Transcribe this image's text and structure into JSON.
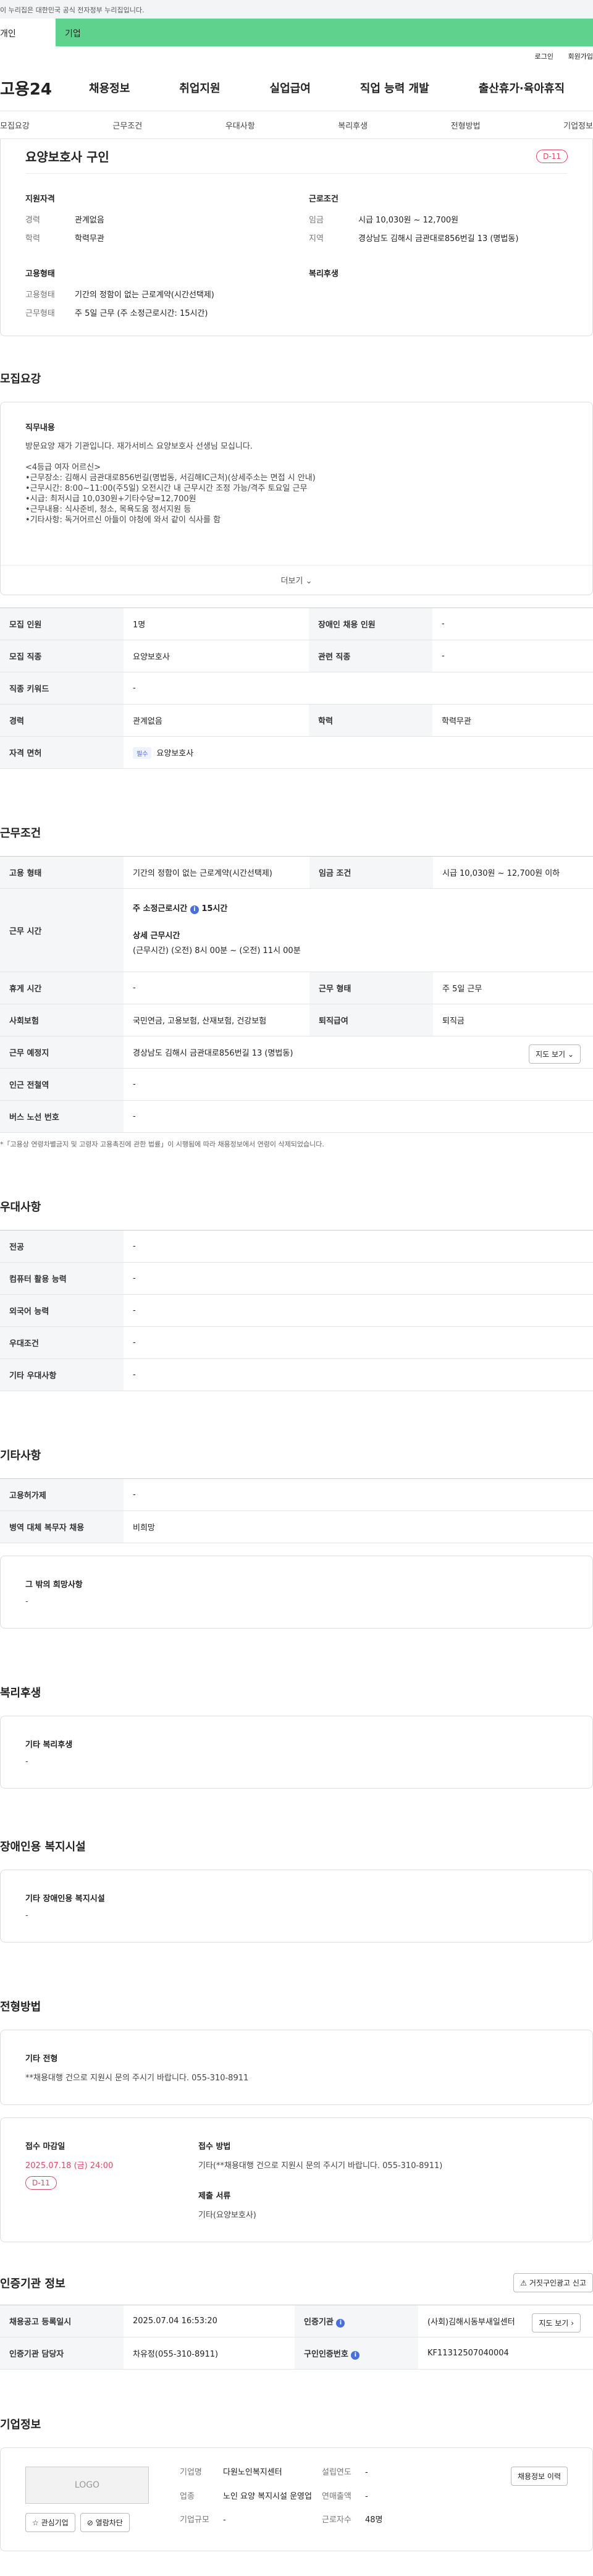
{
  "gov_banner": "이 누리집은 대한민국 공식 전자정부 누리집입니다.",
  "toggle": {
    "left": "개인",
    "right": "기업"
  },
  "util": {
    "login": "로그인",
    "join": "회원가입"
  },
  "gnb": {
    "logo": "고용24",
    "menus": [
      "채용정보",
      "취업지원",
      "실업급여",
      "직업 능력 개발",
      "출산휴가·육아휴직"
    ]
  },
  "subnav": [
    "모집요강",
    "근무조건",
    "우대사항",
    "복리후생",
    "전형방법",
    "기업정보"
  ],
  "summary": {
    "title": "요양보호사 구인",
    "dday": "D-11",
    "qual_title": "지원자격",
    "qual": [
      {
        "k": "경력",
        "v": "관계없음"
      },
      {
        "k": "학력",
        "v": "학력무관"
      }
    ],
    "cond_title": "근로조건",
    "cond": [
      {
        "k": "임금",
        "v": "시급 10,030원 ~ 12,700원"
      },
      {
        "k": "지역",
        "v": "경상남도 김해시 금관대로856번길 13 (명법동)"
      }
    ],
    "emp_title": "고용형태",
    "emp": [
      {
        "k": "고용형태",
        "v": "기간의 정함이 없는 근로계약(시간선택제)"
      },
      {
        "k": "근무형태",
        "v": "주 5일 근무 (주 소정근로시간: 15시간)"
      }
    ],
    "welfare_title": "복리후생"
  },
  "recruit": {
    "title": "모집요강",
    "desc_title": "직무내용",
    "desc_text": "방문요양 재가 기관입니다. 재가서비스 요양보호사 선생님 모십니다.\n\n<4등급 여자 어르신>\n•근무장소: 김해시 금관대로856번길(명법동, 서김해IC근처)(상세주소는 면접 시 안내)\n•근무시간: 8:00~11:00(주5일) 오전시간 내 근무시간 조정 가능/격주 토요일 근무\n•시급: 최저시급 10,030원+기타수당=12,700원\n•근무내용: 식사준비, 청소, 목욕도움 정서지원 등\n•기타사항: 독거어르신 아들이 야청에 와서 같이 식사를 함",
    "more": "더보기",
    "rows": [
      [
        {
          "h": "모집 인원"
        },
        {
          "v": "1명"
        },
        {
          "h": "장애인 채용 인원"
        },
        {
          "v": "-"
        }
      ],
      [
        {
          "h": "모집 직종"
        },
        {
          "v": "요양보호사"
        },
        {
          "h": "관련 직종"
        },
        {
          "v": "-"
        }
      ],
      [
        {
          "h": "직종 키워드"
        },
        {
          "v": "-"
        }
      ],
      [
        {
          "h": "경력"
        },
        {
          "v": "관계없음"
        },
        {
          "h": "학력"
        },
        {
          "v": "학력무관"
        }
      ]
    ],
    "license_h": "자격 면허",
    "license_tag": "필수",
    "license_v": "요양보호사"
  },
  "work": {
    "title": "근무조건",
    "emp_h": "고용 형태",
    "emp_v": "기간의 정함이 없는 근로계약(시간선택제)",
    "wage_h": "임금 조건",
    "wage_v": "시급 10,030원 ~ 12,700원 이하",
    "time_h": "근무 시간",
    "time_l1": "주 소정근로시간",
    "time_l1v": "15시간",
    "time_l2": "상세 근무시간",
    "time_l3": "(근무시간) (오전) 8시 00분 ~ (오전) 11시 00분",
    "rest_h": "휴게 시간",
    "rest_v": "-",
    "form_h": "근무 형태",
    "form_v": "주 5일 근무",
    "ins_h": "사회보험",
    "ins_v": "국민연금, 고용보험, 산재보험, 건강보험",
    "ret_h": "퇴직급여",
    "ret_v": "퇴직금",
    "place_h": "근무 예정지",
    "place_v": "경상남도 김해시 금관대로856번길 13 (명법동)",
    "map_btn": "지도 보기",
    "sub_h": "인근 전철역",
    "sub_v": "-",
    "bus_h": "버스 노선 번호",
    "bus_v": "-",
    "notice": "*「고용상 연령차별금지 및 고령자 고용촉진에 관한 법률」이 시행됨에 따라 채용정보에서 연령이 삭제되었습니다."
  },
  "pref": {
    "title": "우대사항",
    "rows": [
      [
        "전공",
        "-"
      ],
      [
        "컴퓨터 활용 능력",
        "-"
      ],
      [
        "외국어 능력",
        "-"
      ],
      [
        "우대조건",
        "-"
      ],
      [
        "기타 우대사항",
        "-"
      ]
    ]
  },
  "etc": {
    "title": "기타사항",
    "rows": [
      [
        "고용허가제",
        "-"
      ],
      [
        "병역 대체 복무자 채용",
        "비희망"
      ]
    ],
    "box_title": "그 밖의 희망사항",
    "box_v": "-"
  },
  "welfare": {
    "title": "복리후생",
    "box_title": "기타 복리후생",
    "box_v": "-"
  },
  "disabled": {
    "title": "장애인용 복지시설",
    "box_title": "기타 장애인용 복지시설",
    "box_v": "-"
  },
  "select": {
    "title": "전형방법",
    "box_title": "기타 전형",
    "box_v": "**채용대행 건으로 지원시 문의 주시기 바랍니다. 055-310-8911",
    "dl_title": "접수 마감일",
    "dl_v": "2025.07.18 (금) 24:00",
    "dl_dday": "D-11",
    "method_title": "접수 방법",
    "method_v": "기타(**채용대행 건으로 지원시 문의 주시기 바랍니다. 055-310-8911)",
    "doc_title": "제출 서류",
    "doc_v": "기타(요양보호사)"
  },
  "cert": {
    "title": "인증기관 정보",
    "report_btn": "거짓구인광고 신고",
    "r1": [
      "채용공고 등록일시",
      "2025.07.04 16:53:20",
      "인증기관",
      "(사회)김해시동부새일센터"
    ],
    "r2": [
      "인증기관 담당자",
      "차유정(055-310-8911)",
      "구인인증번호",
      "KF11312507040004"
    ],
    "map_btn": "지도 보기"
  },
  "company": {
    "title": "기업정보",
    "logo": "LOGO",
    "fav": "관심기업",
    "block": "열람차단",
    "history_btn": "채용정보 이력",
    "fields": [
      [
        "기업명",
        "다원노인복지센터",
        "설립연도",
        "-"
      ],
      [
        "업종",
        "노인 요양 복지시설 운영업",
        "연매출액",
        "-"
      ],
      [
        "기업규모",
        "-",
        "근로자수",
        "48명"
      ]
    ]
  }
}
